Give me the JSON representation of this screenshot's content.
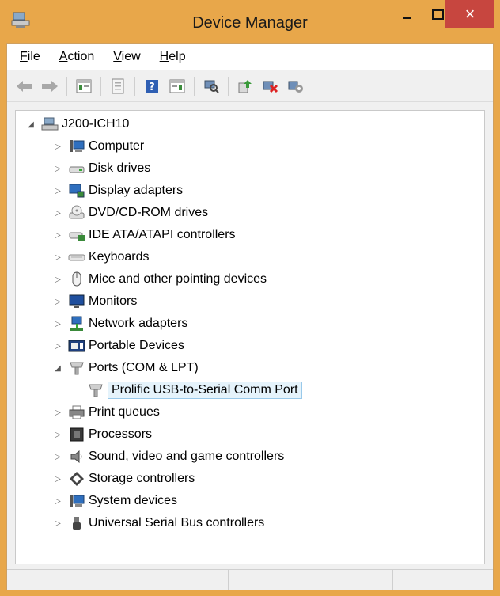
{
  "window": {
    "title": "Device Manager",
    "close_glyph": "×"
  },
  "menu": [
    {
      "label": "File",
      "underline": "F",
      "rest": "ile"
    },
    {
      "label": "Action",
      "underline": "A",
      "rest": "ction"
    },
    {
      "label": "View",
      "underline": "V",
      "rest": "iew"
    },
    {
      "label": "Help",
      "underline": "H",
      "rest": "elp"
    }
  ],
  "toolbar": [
    "back-arrow-icon",
    "forward-arrow-icon",
    "separator",
    "properties-grid-icon",
    "separator",
    "page-icon",
    "separator",
    "help-icon",
    "details-grid-icon",
    "separator",
    "scan-hardware-icon",
    "separator",
    "update-driver-icon",
    "disable-device-icon",
    "uninstall-device-icon"
  ],
  "tree": {
    "root": {
      "label": "J200-ICH10",
      "icon": "computer-root-icon"
    },
    "items": [
      {
        "label": "Computer",
        "icon": "computer-icon",
        "expanded": false
      },
      {
        "label": "Disk drives",
        "icon": "disk-drive-icon",
        "expanded": false
      },
      {
        "label": "Display adapters",
        "icon": "display-adapter-icon",
        "expanded": false
      },
      {
        "label": "DVD/CD-ROM drives",
        "icon": "dvd-drive-icon",
        "expanded": false
      },
      {
        "label": "IDE ATA/ATAPI controllers",
        "icon": "ide-controller-icon",
        "expanded": false
      },
      {
        "label": "Keyboards",
        "icon": "keyboard-icon",
        "expanded": false
      },
      {
        "label": "Mice and other pointing devices",
        "icon": "mouse-icon",
        "expanded": false
      },
      {
        "label": "Monitors",
        "icon": "monitor-icon",
        "expanded": false
      },
      {
        "label": "Network adapters",
        "icon": "network-adapter-icon",
        "expanded": false
      },
      {
        "label": "Portable Devices",
        "icon": "portable-device-icon",
        "expanded": false
      },
      {
        "label": "Ports (COM & LPT)",
        "icon": "port-icon",
        "expanded": true,
        "children": [
          {
            "label": "Prolific USB-to-Serial Comm Port",
            "icon": "port-icon",
            "selected": true
          }
        ]
      },
      {
        "label": "Print queues",
        "icon": "printer-icon",
        "expanded": false
      },
      {
        "label": "Processors",
        "icon": "processor-icon",
        "expanded": false
      },
      {
        "label": "Sound, video and game controllers",
        "icon": "speaker-icon",
        "expanded": false
      },
      {
        "label": "Storage controllers",
        "icon": "storage-controller-icon",
        "expanded": false
      },
      {
        "label": "System devices",
        "icon": "system-device-icon",
        "expanded": false
      },
      {
        "label": "Universal Serial Bus controllers",
        "icon": "usb-icon",
        "expanded": false
      }
    ]
  },
  "colors": {
    "frame": "#e8a74a",
    "close": "#c7463f",
    "selection_bg": "#e5f3fb",
    "selection_border": "#99c9ea"
  }
}
